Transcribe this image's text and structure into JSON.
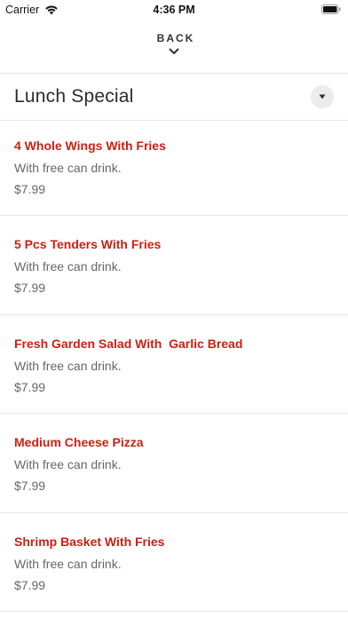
{
  "status_bar": {
    "carrier": "Carrier",
    "time": "4:36 PM"
  },
  "nav": {
    "back_label": "BACK"
  },
  "section": {
    "title": "Lunch Special"
  },
  "items": [
    {
      "name": "4 Whole Wings With Fries",
      "description": "With free can drink.",
      "price": "$7.99"
    },
    {
      "name": "5 Pcs Tenders With Fries",
      "description": "With free can drink.",
      "price": "$7.99"
    },
    {
      "name": "Fresh Garden Salad With  Garlic Bread",
      "description": "With free can drink.",
      "price": "$7.99"
    },
    {
      "name": "Medium Cheese Pizza",
      "description": "With free can drink.",
      "price": "$7.99"
    },
    {
      "name": "Shrimp Basket With Fries",
      "description": "With free can drink.",
      "price": "$7.99"
    }
  ],
  "colors": {
    "item_name": "#cc1f12",
    "secondary_text": "#666666",
    "divider": "#e6e6e6"
  }
}
